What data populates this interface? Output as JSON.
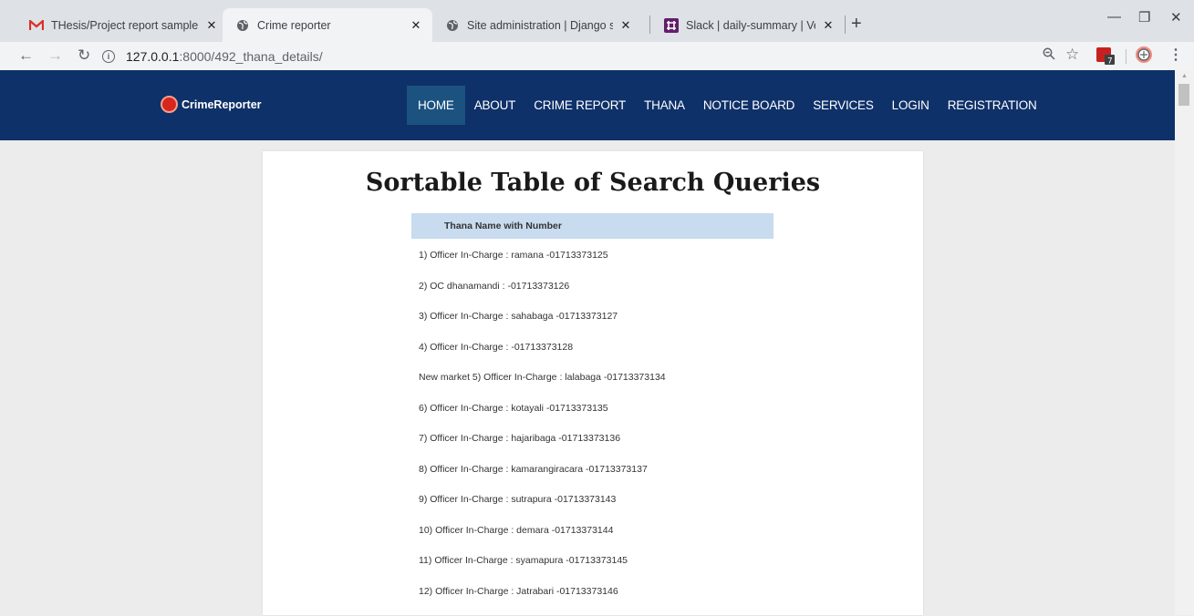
{
  "browser": {
    "tabs": [
      {
        "title": "THesis/Project report sample - ju",
        "icon": "gmail-icon"
      },
      {
        "title": "Crime reporter",
        "icon": "globe-icon"
      },
      {
        "title": "Site administration | Django site",
        "icon": "globe-icon"
      },
      {
        "title": "Slack | daily-summary | Venture S",
        "icon": "slack-icon"
      }
    ],
    "url_host": "127.0.0.1",
    "url_path": ":8000/492_thana_details/"
  },
  "site": {
    "logo_text": "CrimeReporter",
    "nav": [
      "HOME",
      "ABOUT",
      "CRIME REPORT",
      "THANA",
      "NOTICE BOARD",
      "SERVICES",
      "LOGIN",
      "REGISTRATION"
    ],
    "active_nav": "HOME"
  },
  "main": {
    "title": "Sortable Table of Search Queries",
    "column_header": "Thana Name with Number",
    "rows": [
      "1) Officer In-Charge : ramana -01713373125",
      "2) OC dhanamandi : -01713373126",
      "3) Officer In-Charge : sahabaga -01713373127",
      "4) Officer In-Charge : -01713373128",
      "New market 5) Officer In-Charge : lalabaga -01713373134",
      "6) Officer In-Charge : kotayali -01713373135",
      "7) Officer In-Charge : hajaribaga -01713373136",
      "8) Officer In-Charge : kamarangiracara -01713373137",
      "9) Officer In-Charge : sutrapura -01713373143",
      "10) Officer In-Charge : demara -01713373144",
      "11) Officer In-Charge : syamapura -01713373145",
      "12) Officer In-Charge : Jatrabari -01713373146"
    ]
  }
}
